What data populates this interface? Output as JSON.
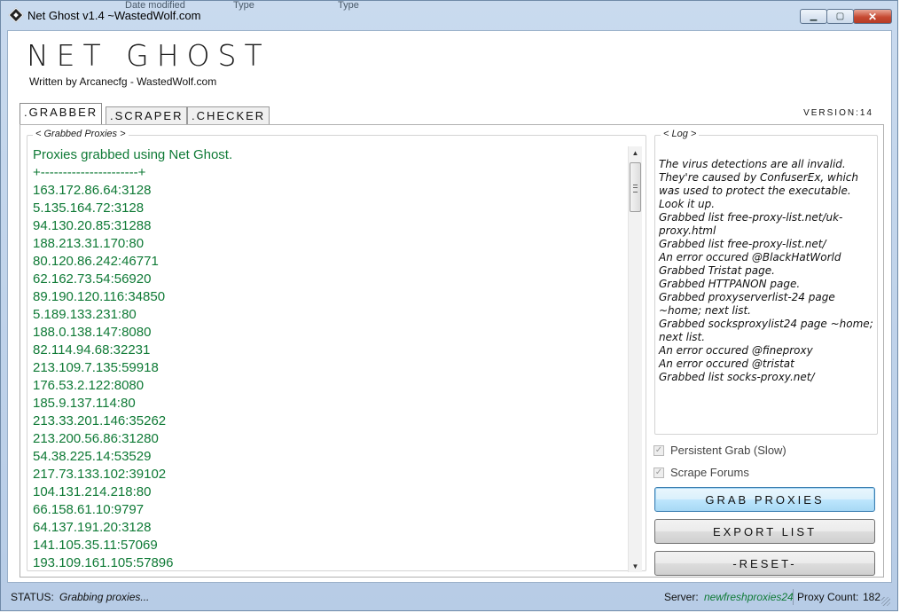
{
  "window": {
    "title": "Net Ghost v1.4 ~WastedWolf.com",
    "ghost_headers": [
      "Date modified",
      "Type",
      "Type"
    ],
    "minimize": "▁",
    "maximize": "▢",
    "close": "✕"
  },
  "header": {
    "logo": "NET GHOST",
    "byline": "Written by Arcanecfg - WastedWolf.com",
    "version": "VERSION:14"
  },
  "tabs": [
    {
      "label": ".GRABBER",
      "active": true
    },
    {
      "label": ".SCRAPER",
      "active": false
    },
    {
      "label": ".CHECKER",
      "active": false
    }
  ],
  "grabbed": {
    "label": "< Grabbed Proxies >",
    "heading": "Proxies grabbed using Net Ghost.",
    "divider": "+----------------------+",
    "proxies": [
      "163.172.86.64:3128",
      "5.135.164.72:3128",
      "94.130.20.85:31288",
      "188.213.31.170:80",
      "80.120.86.242:46771",
      "62.162.73.54:56920",
      "89.190.120.116:34850",
      "5.189.133.231:80",
      "188.0.138.147:8080",
      "82.114.94.68:32231",
      "213.109.7.135:59918",
      "176.53.2.122:8080",
      "185.9.137.114:80",
      "213.33.201.146:35262",
      "213.200.56.86:31280",
      "54.38.225.14:53529",
      "217.73.133.102:39102",
      "104.131.214.218:80",
      "66.158.61.10:9797",
      "64.137.191.20:3128",
      "141.105.35.11:57069",
      "193.109.161.105:57896"
    ]
  },
  "log": {
    "label": "< Log >",
    "entries": [
      "The virus detections are all invalid. They're caused by ConfuserEx, which was used to protect the executable. Look it up.",
      "Grabbed list free-proxy-list.net/uk-proxy.html",
      "Grabbed list free-proxy-list.net/",
      "An error occured @BlackHatWorld",
      "Grabbed Tristat page.",
      "Grabbed HTTPANON page.",
      "Grabbed proxyserverlist-24 page ~home; next list.",
      "Grabbed socksproxylist24 page ~home; next list.",
      "An error occured @fineproxy",
      "An error occured @tristat",
      "Grabbed list socks-proxy.net/"
    ]
  },
  "options": {
    "persistent_grab": {
      "label": "Persistent Grab (Slow)",
      "checked": true,
      "check": "✓"
    },
    "scrape_forums": {
      "label": "Scrape Forums",
      "checked": true,
      "check": "✓"
    }
  },
  "buttons": {
    "grab": "GRAB PROXIES",
    "export": "EXPORT LIST",
    "reset": "-RESET-"
  },
  "status": {
    "label": "STATUS:",
    "value": "Grabbing proxies...",
    "server_label": "Server:",
    "server_value": "newfreshproxies24",
    "count_label": "Proxy Count:",
    "count_value": "182"
  },
  "colors": {
    "proxy_text": "#0f7a36",
    "titlebar": "#c9daee",
    "close_button": "#c64a33"
  }
}
